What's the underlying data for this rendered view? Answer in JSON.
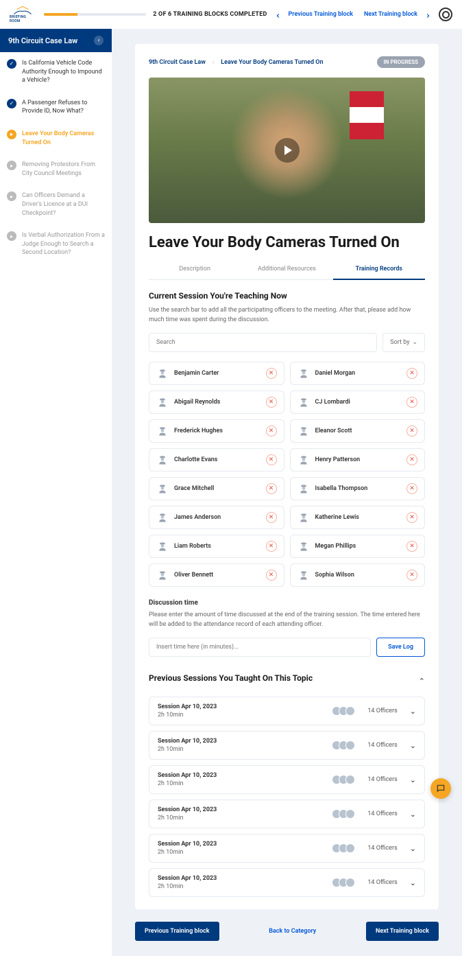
{
  "header": {
    "logo_text": "BRIEFING ROOM",
    "progress_text": "2 OF 6 TRAINING BLOCKS COMPLETED",
    "prev_label": "Previous Training block",
    "next_label": "Next Training block"
  },
  "sidebar": {
    "title": "9th Circuit Case Law",
    "items": [
      {
        "label": "Is California Vehicle Code Authority Enough to Impound a Vehicle?",
        "state": "done"
      },
      {
        "label": "A Passenger Refuses to Provide ID, Now What?",
        "state": "done"
      },
      {
        "label": "Leave Your Body Cameras Turned On",
        "state": "active"
      },
      {
        "label": "Removing Protestors From City Council Meetings",
        "state": "future"
      },
      {
        "label": "Can Officers Demand a Driver's Licence at a DUI Checkpoint?",
        "state": "future"
      },
      {
        "label": "Is Verbal Authorization From a Judge Enough to Search a Second Location?",
        "state": "future"
      }
    ]
  },
  "breadcrumbs": {
    "root": "9th Circuit Case Law",
    "current": "Leave Your Body Cameras Turned On",
    "status": "IN PROGRESS"
  },
  "title": "Leave Your Body Cameras Turned On",
  "tabs": {
    "description": "Description",
    "resources": "Additional Resources",
    "records": "Training Records"
  },
  "current_session": {
    "heading": "Current Session You're Teaching Now",
    "help": "Use the search bar to add all the participating officers to the meeting. After that, please add how much time was spent during the discussion.",
    "search_placeholder": "Search",
    "sort_label": "Sort by",
    "officers_left": [
      "Benjamin Carter",
      "Abigail Reynolds",
      "Frederick Hughes",
      "Charlotte Evans",
      "Grace Mitchell",
      "James Anderson",
      "Liam Roberts",
      "Oliver Bennett"
    ],
    "officers_right": [
      "Daniel Morgan",
      "CJ Lombardi",
      "Eleanor Scott",
      "Henry Patterson",
      "Isabella Thompson",
      "Katherine Lewis",
      "Megan Phillips",
      "Sophia Wilson"
    ]
  },
  "discussion": {
    "label": "Discussion time",
    "help": "Please enter the amount of time discussed at the end of the training session. The time entered here will be added to the attendance record of each attending officer.",
    "placeholder": "Insert time here (in minutes)...",
    "save_label": "Save Log"
  },
  "previous": {
    "heading": "Previous Sessions You Taught On This Topic",
    "sessions": [
      {
        "title": "Session Apr 10, 2023",
        "dur": "2h 10min",
        "count": "14 Officers"
      },
      {
        "title": "Session Apr 10, 2023",
        "dur": "2h 10min",
        "count": "14 Officers"
      },
      {
        "title": "Session Apr 10, 2023",
        "dur": "2h 10min",
        "count": "14 Officers"
      },
      {
        "title": "Session Apr 10, 2023",
        "dur": "2h 10min",
        "count": "14 Officers"
      },
      {
        "title": "Session Apr 10, 2023",
        "dur": "2h 10min",
        "count": "14 Officers"
      },
      {
        "title": "Session Apr 10, 2023",
        "dur": "2h 10min",
        "count": "14 Officers"
      }
    ]
  },
  "footer": {
    "prev": "Previous Training block",
    "back": "Back to Category",
    "next": "Next Training block"
  }
}
